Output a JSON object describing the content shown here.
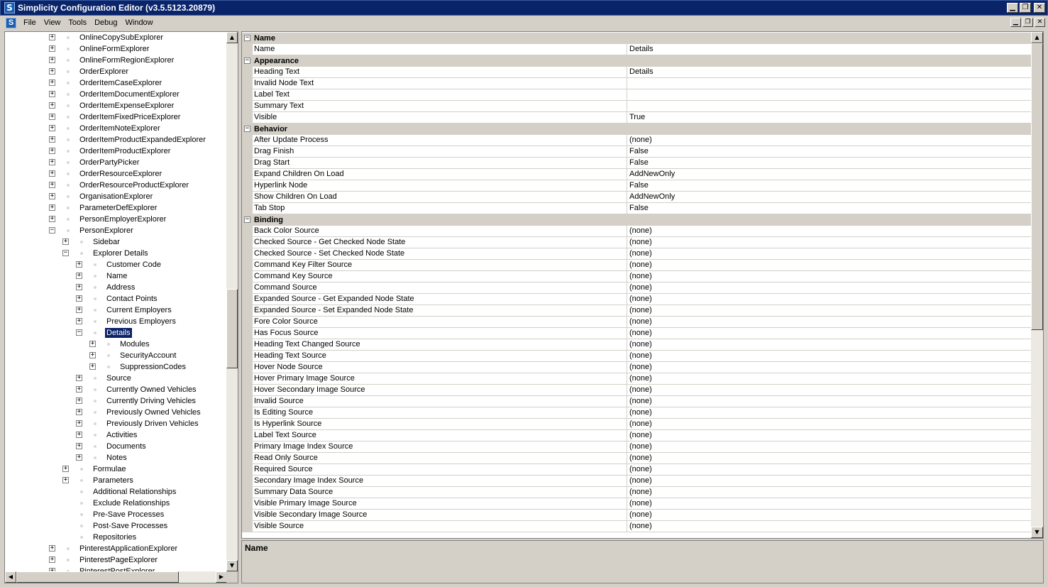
{
  "window": {
    "title": "Simplicity Configuration Editor (v3.5.5123.20879)",
    "app_icon_letter": "S",
    "minimize_glyph": "▁",
    "restore_glyph": "❐",
    "close_glyph": "✕"
  },
  "menu": {
    "items": [
      "File",
      "View",
      "Tools",
      "Debug",
      "Window"
    ],
    "mdi_buttons": [
      "▁",
      "❐",
      "✕"
    ]
  },
  "tree": {
    "nodes": [
      {
        "label": "OnlineCopySubExplorer",
        "level": 0,
        "expander": "+"
      },
      {
        "label": "OnlineFormExplorer",
        "level": 0,
        "expander": "+"
      },
      {
        "label": "OnlineFormRegionExplorer",
        "level": 0,
        "expander": "+"
      },
      {
        "label": "OrderExplorer",
        "level": 0,
        "expander": "+"
      },
      {
        "label": "OrderItemCaseExplorer",
        "level": 0,
        "expander": "+"
      },
      {
        "label": "OrderItemDocumentExplorer",
        "level": 0,
        "expander": "+"
      },
      {
        "label": "OrderItemExpenseExplorer",
        "level": 0,
        "expander": "+"
      },
      {
        "label": "OrderItemFixedPriceExplorer",
        "level": 0,
        "expander": "+"
      },
      {
        "label": "OrderItemNoteExplorer",
        "level": 0,
        "expander": "+"
      },
      {
        "label": "OrderItemProductExpandedExplorer",
        "level": 0,
        "expander": "+"
      },
      {
        "label": "OrderItemProductExplorer",
        "level": 0,
        "expander": "+"
      },
      {
        "label": "OrderPartyPicker",
        "level": 0,
        "expander": "+"
      },
      {
        "label": "OrderResourceExplorer",
        "level": 0,
        "expander": "+"
      },
      {
        "label": "OrderResourceProductExplorer",
        "level": 0,
        "expander": "+"
      },
      {
        "label": "OrganisationExplorer",
        "level": 0,
        "expander": "+"
      },
      {
        "label": "ParameterDefExplorer",
        "level": 0,
        "expander": "+"
      },
      {
        "label": "PersonEmployerExplorer",
        "level": 0,
        "expander": "+"
      },
      {
        "label": "PersonExplorer",
        "level": 0,
        "expander": "−"
      },
      {
        "label": "Sidebar",
        "level": 1,
        "expander": "+"
      },
      {
        "label": "Explorer Details",
        "level": 1,
        "expander": "−"
      },
      {
        "label": "Customer Code",
        "level": 2,
        "expander": "+"
      },
      {
        "label": "Name",
        "level": 2,
        "expander": "+"
      },
      {
        "label": "Address",
        "level": 2,
        "expander": "+"
      },
      {
        "label": "Contact Points",
        "level": 2,
        "expander": "+"
      },
      {
        "label": "Current Employers",
        "level": 2,
        "expander": "+"
      },
      {
        "label": "Previous Employers",
        "level": 2,
        "expander": "+"
      },
      {
        "label": "Details",
        "level": 2,
        "expander": "−",
        "selected": true
      },
      {
        "label": "Modules",
        "level": 3,
        "expander": "+"
      },
      {
        "label": "SecurityAccount",
        "level": 3,
        "expander": "+"
      },
      {
        "label": "SuppressionCodes",
        "level": 3,
        "expander": "+"
      },
      {
        "label": "Source",
        "level": 2,
        "expander": "+"
      },
      {
        "label": "Currently Owned Vehicles",
        "level": 2,
        "expander": "+"
      },
      {
        "label": "Currently Driving Vehicles",
        "level": 2,
        "expander": "+"
      },
      {
        "label": "Previously Owned Vehicles",
        "level": 2,
        "expander": "+"
      },
      {
        "label": "Previously Driven Vehicles",
        "level": 2,
        "expander": "+"
      },
      {
        "label": "Activities",
        "level": 2,
        "expander": "+"
      },
      {
        "label": "Documents",
        "level": 2,
        "expander": "+"
      },
      {
        "label": "Notes",
        "level": 2,
        "expander": "+"
      },
      {
        "label": "Formulae",
        "level": 1,
        "expander": "+"
      },
      {
        "label": "Parameters",
        "level": 1,
        "expander": "+"
      },
      {
        "label": "Additional Relationships",
        "level": 1,
        "expander": ""
      },
      {
        "label": "Exclude Relationships",
        "level": 1,
        "expander": ""
      },
      {
        "label": "Pre-Save Processes",
        "level": 1,
        "expander": ""
      },
      {
        "label": "Post-Save Processes",
        "level": 1,
        "expander": ""
      },
      {
        "label": "Repositories",
        "level": 1,
        "expander": ""
      },
      {
        "label": "PinterestApplicationExplorer",
        "level": 0,
        "expander": "+"
      },
      {
        "label": "PinterestPageExplorer",
        "level": 0,
        "expander": "+"
      },
      {
        "label": "PinterestPostExplorer",
        "level": 0,
        "expander": "+"
      }
    ]
  },
  "properties": {
    "rows": [
      {
        "type": "category",
        "label": "Name"
      },
      {
        "type": "prop",
        "name": "Name",
        "value": "Details"
      },
      {
        "type": "category",
        "label": "Appearance"
      },
      {
        "type": "prop",
        "name": "Heading Text",
        "value": "Details"
      },
      {
        "type": "prop",
        "name": "Invalid Node Text",
        "value": ""
      },
      {
        "type": "prop",
        "name": "Label Text",
        "value": ""
      },
      {
        "type": "prop",
        "name": "Summary Text",
        "value": ""
      },
      {
        "type": "prop",
        "name": "Visible",
        "value": "True"
      },
      {
        "type": "category",
        "label": "Behavior"
      },
      {
        "type": "prop",
        "name": "After Update Process",
        "value": "(none)"
      },
      {
        "type": "prop",
        "name": "Drag Finish",
        "value": "False"
      },
      {
        "type": "prop",
        "name": "Drag Start",
        "value": "False"
      },
      {
        "type": "prop",
        "name": "Expand Children On Load",
        "value": "AddNewOnly"
      },
      {
        "type": "prop",
        "name": "Hyperlink Node",
        "value": "False"
      },
      {
        "type": "prop",
        "name": "Show Children On Load",
        "value": "AddNewOnly"
      },
      {
        "type": "prop",
        "name": "Tab Stop",
        "value": "False"
      },
      {
        "type": "category",
        "label": "Binding"
      },
      {
        "type": "prop",
        "name": "Back Color Source",
        "value": "(none)"
      },
      {
        "type": "prop",
        "name": "Checked Source - Get Checked Node State",
        "value": "(none)"
      },
      {
        "type": "prop",
        "name": "Checked Source - Set Checked Node State",
        "value": "(none)"
      },
      {
        "type": "prop",
        "name": "Command Key Filter Source",
        "value": "(none)"
      },
      {
        "type": "prop",
        "name": "Command Key Source",
        "value": "(none)"
      },
      {
        "type": "prop",
        "name": "Command Source",
        "value": "(none)"
      },
      {
        "type": "prop",
        "name": "Expanded Source - Get Expanded Node State",
        "value": "(none)"
      },
      {
        "type": "prop",
        "name": "Expanded Source - Set Expanded Node State",
        "value": "(none)"
      },
      {
        "type": "prop",
        "name": "Fore Color Source",
        "value": "(none)"
      },
      {
        "type": "prop",
        "name": "Has Focus Source",
        "value": "(none)"
      },
      {
        "type": "prop",
        "name": "Heading Text Changed Source",
        "value": "(none)"
      },
      {
        "type": "prop",
        "name": "Heading Text Source",
        "value": "(none)"
      },
      {
        "type": "prop",
        "name": "Hover Node Source",
        "value": "(none)"
      },
      {
        "type": "prop",
        "name": "Hover Primary Image Source",
        "value": "(none)"
      },
      {
        "type": "prop",
        "name": "Hover Secondary Image Source",
        "value": "(none)"
      },
      {
        "type": "prop",
        "name": "Invalid Source",
        "value": "(none)"
      },
      {
        "type": "prop",
        "name": "Is Editing Source",
        "value": "(none)"
      },
      {
        "type": "prop",
        "name": "Is Hyperlink Source",
        "value": "(none)"
      },
      {
        "type": "prop",
        "name": "Label Text Source",
        "value": "(none)"
      },
      {
        "type": "prop",
        "name": "Primary Image Index Source",
        "value": "(none)"
      },
      {
        "type": "prop",
        "name": "Read Only Source",
        "value": "(none)"
      },
      {
        "type": "prop",
        "name": "Required Source",
        "value": "(none)"
      },
      {
        "type": "prop",
        "name": "Secondary Image Index Source",
        "value": "(none)"
      },
      {
        "type": "prop",
        "name": "Summary Data Source",
        "value": "(none)"
      },
      {
        "type": "prop",
        "name": "Visible Primary Image Source",
        "value": "(none)"
      },
      {
        "type": "prop",
        "name": "Visible Secondary Image Source",
        "value": "(none)"
      },
      {
        "type": "prop",
        "name": "Visible Source",
        "value": "(none)"
      }
    ]
  },
  "description": {
    "title": "Name"
  }
}
